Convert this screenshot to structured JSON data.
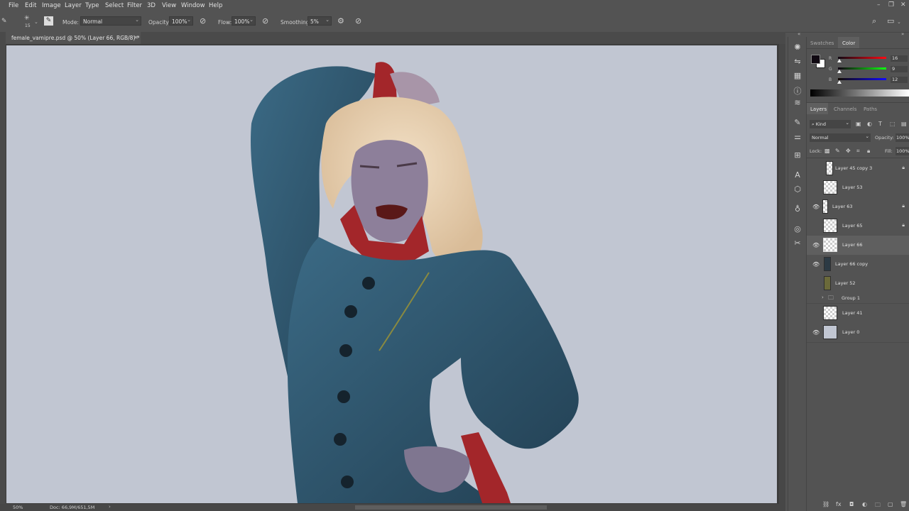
{
  "menu": {
    "items": [
      "File",
      "Edit",
      "Image",
      "Layer",
      "Type",
      "Select",
      "Filter",
      "3D",
      "View",
      "Window",
      "Help"
    ]
  },
  "options": {
    "brush_size": "15",
    "mode_label": "Mode:",
    "mode_value": "Normal",
    "opacity_label": "Opacity:",
    "opacity_value": "100%",
    "flow_label": "Flow:",
    "flow_value": "100%",
    "smoothing_label": "Smoothing:",
    "smoothing_value": "5%"
  },
  "document": {
    "tab_title": "female_vamipre.psd @ 50% (Layer 66, RGB/8) *",
    "close": "×"
  },
  "status": {
    "zoom": "50%",
    "doc_info": "Doc: 66,9M/651,5M"
  },
  "color_panel": {
    "tabs": [
      "Swatches",
      "Color"
    ],
    "active_tab": "Color",
    "channels": [
      {
        "label": "R",
        "value": "16",
        "color": "#e03030"
      },
      {
        "label": "G",
        "value": "9",
        "color": "#30b030"
      },
      {
        "label": "B",
        "value": "12",
        "color": "#3040e0"
      }
    ]
  },
  "layers_panel": {
    "tabs": [
      "Layers",
      "Channels",
      "Paths"
    ],
    "active_tab": "Layers",
    "kind_label": "Kind",
    "blend_mode": "Normal",
    "opacity_label": "Opacity:",
    "opacity_value": "100%",
    "lock_label": "Lock:",
    "fill_label": "Fill:",
    "fill_value": "100%",
    "layers": [
      {
        "name": "Layer 45 copy 3",
        "visible": false,
        "locked": true,
        "selected": false
      },
      {
        "name": "Layer 53",
        "visible": false,
        "locked": false,
        "selected": false
      },
      {
        "name": "Layer 63",
        "visible": true,
        "locked": true,
        "selected": false
      },
      {
        "name": "Layer 65",
        "visible": false,
        "locked": true,
        "selected": false
      },
      {
        "name": "Layer 66",
        "visible": true,
        "locked": false,
        "selected": true
      },
      {
        "name": "Layer 66 copy",
        "visible": true,
        "locked": false,
        "selected": false
      },
      {
        "name": "Layer 52",
        "visible": false,
        "locked": false,
        "selected": false
      },
      {
        "name": "Group 1",
        "visible": false,
        "locked": false,
        "selected": false,
        "is_group": true
      },
      {
        "name": "Layer 41",
        "visible": false,
        "locked": false,
        "selected": false
      },
      {
        "name": "Layer 0",
        "visible": true,
        "locked": false,
        "selected": false
      }
    ]
  },
  "colors": {
    "ui_bg": "#535353",
    "canvas_bg": "#c1c6d2",
    "coat": "#2f5a72",
    "collar_red": "#a3262a",
    "skin": "#8d7f9a",
    "hair": "#e6cfb0"
  }
}
